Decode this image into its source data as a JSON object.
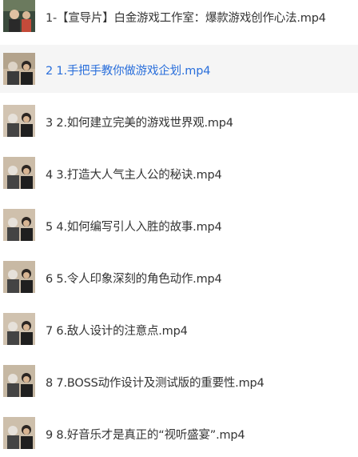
{
  "playlist": {
    "items": [
      {
        "label": "1-【宣导片】白金游戏工作室：爆款游戏创作心法.mp4",
        "thumbnail_icon": "video-thumbnail-icon",
        "active": false
      },
      {
        "label": "2 1.手把手教你做游戏企划.mp4",
        "thumbnail_icon": "video-thumbnail-icon",
        "active": true
      },
      {
        "label": "3 2.如何建立完美的游戏世界观.mp4",
        "thumbnail_icon": "video-thumbnail-icon",
        "active": false
      },
      {
        "label": "4 3.打造大人气主人公的秘诀.mp4",
        "thumbnail_icon": "video-thumbnail-icon",
        "active": false
      },
      {
        "label": "5 4.如何编写引人入胜的故事.mp4",
        "thumbnail_icon": "video-thumbnail-icon",
        "active": false
      },
      {
        "label": "6 5.令人印象深刻的角色动作.mp4",
        "thumbnail_icon": "video-thumbnail-icon",
        "active": false
      },
      {
        "label": "7 6.敌人设计的注意点.mp4",
        "thumbnail_icon": "video-thumbnail-icon",
        "active": false
      },
      {
        "label": "8 7.BOSS动作设计及测试版的重要性.mp4",
        "thumbnail_icon": "video-thumbnail-icon",
        "active": false
      },
      {
        "label": "9 8.好音乐才是真正的“视听盛宴”.mp4",
        "thumbnail_icon": "video-thumbnail-icon",
        "active": false
      }
    ],
    "colors": {
      "active_text": "#2a6fdb",
      "normal_text": "#333333",
      "active_background": "#f5f5f5"
    }
  }
}
